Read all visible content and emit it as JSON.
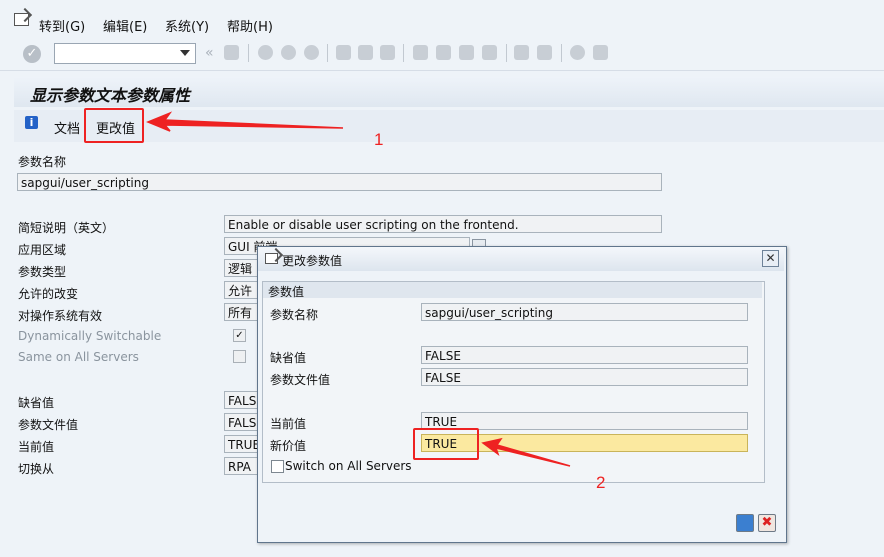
{
  "menu": {
    "goto": "转到(G)",
    "edit": "编辑(E)",
    "system": "系统(Y)",
    "help": "帮助(H)"
  },
  "toolbar": {
    "ok_icon": "checkmark-icon",
    "command_field_value": "",
    "buttons": [
      "back-icon",
      "save-icon",
      "exit-icon",
      "cancel-icon",
      "print-icon",
      "find-icon",
      "find-next-icon",
      "first-page-icon",
      "prev-page-icon",
      "next-page-icon",
      "last-page-icon",
      "new-session-icon",
      "shortcut-icon",
      "help-icon",
      "customize-layout-icon"
    ]
  },
  "screen": {
    "title": "显示参数文本参数属性",
    "app_toolbar": {
      "info_icon": "i",
      "doc_label": "文档",
      "change_value_label": "更改值"
    }
  },
  "params": {
    "name_label": "参数名称",
    "name_value": "sapgui/user_scripting",
    "short_desc_label": "简短说明（英文）",
    "short_desc_value": "Enable or disable user scripting on the frontend.",
    "app_area_label": "应用区域",
    "app_area_value": "GUI 前端",
    "param_type_label": "参数类型",
    "param_type_value": "逻辑",
    "allowed_changes_label": "允许的改变",
    "allowed_changes_value": "允许",
    "valid_for_label": "对操作系统有效",
    "valid_for_value": "所有",
    "dyn_switch_label": "Dynamically Switchable",
    "dyn_switch_checked": "✓",
    "same_servers_label": "Same on All Servers",
    "default_label": "缺省值",
    "default_value": "FALS",
    "profile_label": "参数文件值",
    "profile_value": "FALS",
    "current_label": "当前值",
    "current_value": "TRUE",
    "switched_from_label": "切换从",
    "switched_from_value": "RPA"
  },
  "dialog": {
    "title": "更改参数值",
    "close": "✕",
    "group_title": "参数值",
    "name_label": "参数名称",
    "name_value": "sapgui/user_scripting",
    "default_label": "缺省值",
    "default_value": "FALSE",
    "profile_label": "参数文件值",
    "profile_value": "FALSE",
    "current_label": "当前值",
    "current_value": "TRUE",
    "new_label": "新价值",
    "new_value": "TRUE",
    "switch_all_label": "Switch on All Servers",
    "save_icon": "save-icon",
    "cancel_icon": "cancel-icon",
    "cancel_glyph": "✖"
  },
  "annotations": {
    "step1": "1",
    "step2": "2"
  },
  "colors": {
    "callout": "#e22222",
    "new_value_bg": "#fbe9a0",
    "info_icon": "#2462c7"
  }
}
